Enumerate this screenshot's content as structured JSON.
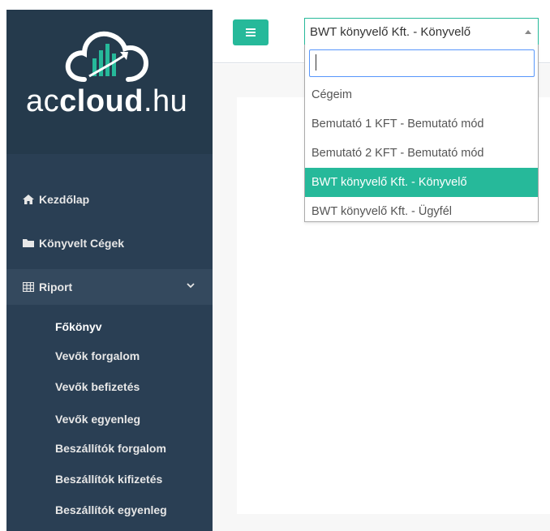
{
  "brand": {
    "logo_prefix": "ac",
    "logo_bold": "cloud",
    "logo_suffix": ".hu"
  },
  "sidebar": {
    "items": [
      {
        "label": "Kezdőlap",
        "icon": "home-icon"
      },
      {
        "label": "Könyvelt Cégek",
        "icon": "folder-icon"
      },
      {
        "label": "Riport",
        "icon": "table-icon",
        "expanded": true
      }
    ],
    "sub_items": [
      {
        "label": "Főkönyv",
        "active": true
      },
      {
        "label": "Vevők forgalom"
      },
      {
        "label": "Vevők befizetés"
      },
      {
        "label": "Vevők egyenleg"
      },
      {
        "label": "Beszállítók forgalom"
      },
      {
        "label": "Beszállítók kifizetés"
      },
      {
        "label": "Beszállítók egyenleg"
      }
    ]
  },
  "company_select": {
    "selected": "BWT könyvelő Kft. - Könyvelő",
    "search_value": "",
    "options": [
      {
        "label": "Cégeim"
      },
      {
        "label": "Bemutató 1 KFT - Bemutató mód"
      },
      {
        "label": "Bemutató 2 KFT - Bemutató mód"
      },
      {
        "label": "BWT könyvelő Kft. - Könyvelő",
        "highlighted": true
      },
      {
        "label": "BWT könyvelő Kft. - Ügyfél"
      }
    ]
  },
  "colors": {
    "sidebar_bg": "#2a3f54",
    "accent": "#26b99a",
    "search_focus": "#5897fb"
  }
}
